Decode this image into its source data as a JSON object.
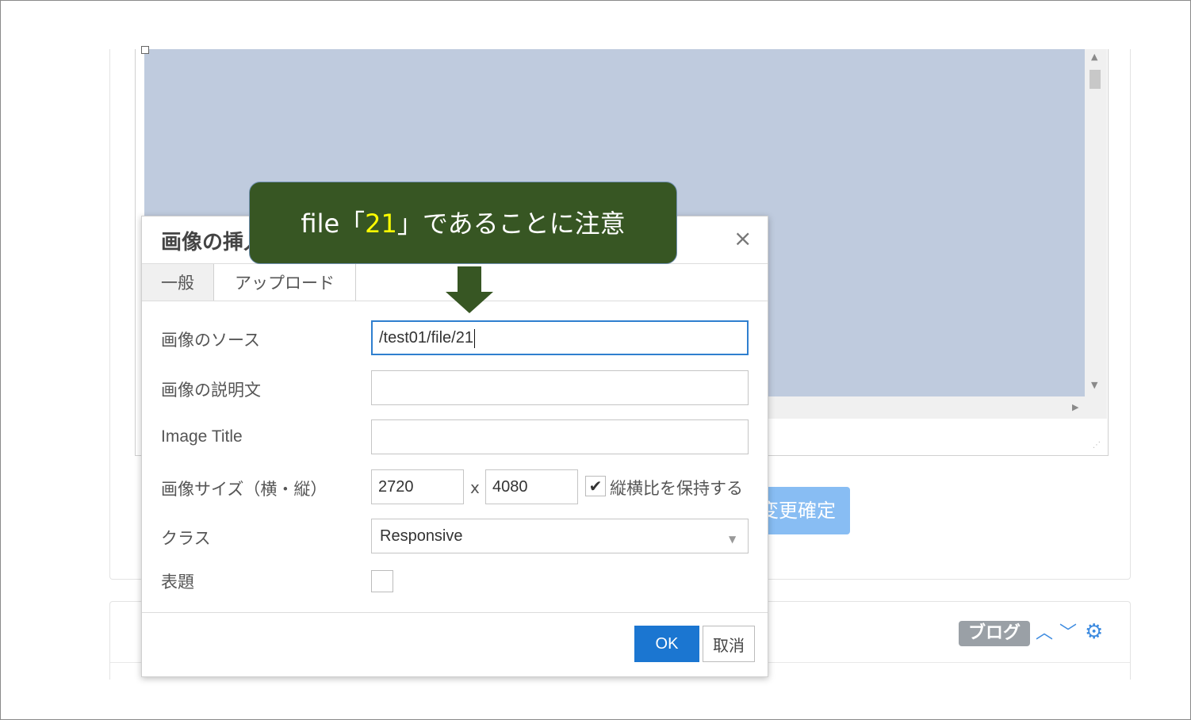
{
  "dialog": {
    "title": "画像の挿入",
    "close_glyph": "×",
    "tabs": [
      {
        "label": "一般",
        "active": true
      },
      {
        "label": "アップロード",
        "active": false
      }
    ],
    "fields": {
      "source": {
        "label": "画像のソース",
        "value": "/test01/file/21"
      },
      "description": {
        "label": "画像の説明文",
        "value": ""
      },
      "title": {
        "label": "Image Title",
        "value": ""
      },
      "size": {
        "label": "画像サイズ（横・縦）",
        "width": "2720",
        "separator": "x",
        "height": "4080",
        "keep_ratio_label": "縦横比を保持する",
        "keep_ratio_checked": true
      },
      "class": {
        "label": "クラス",
        "value": "Responsive"
      },
      "caption": {
        "label": "表題",
        "checked": false
      }
    },
    "buttons": {
      "ok": "OK",
      "cancel": "取消"
    }
  },
  "background": {
    "confirm_button": "変更確定",
    "blog_badge": "ブログ",
    "accent_color": "#3d8be0"
  },
  "annotation": {
    "text_before": "file「",
    "highlight": "21",
    "text_after": "」であることに注意",
    "box_color": "#375623",
    "highlight_color": "#ffff00"
  }
}
